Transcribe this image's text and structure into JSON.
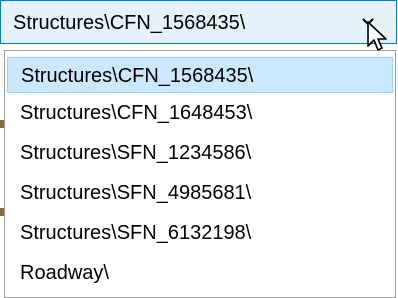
{
  "combo": {
    "value": "Structures\\CFN_1568435\\",
    "arrow_icon": "chevron-down-icon"
  },
  "dropdown": {
    "options": [
      {
        "label": "Structures\\CFN_1568435\\",
        "selected": true
      },
      {
        "label": "Structures\\CFN_1648453\\",
        "selected": false
      },
      {
        "label": "Structures\\SFN_1234586\\",
        "selected": false
      },
      {
        "label": "Structures\\SFN_4985681\\",
        "selected": false
      },
      {
        "label": "Structures\\SFN_6132198\\",
        "selected": false
      },
      {
        "label": "Roadway\\",
        "selected": false
      }
    ]
  },
  "colors": {
    "combo_background": "#e5f1fb",
    "combo_border": "#0078d7",
    "selected_background": "#cce8ff",
    "selected_border": "#99d1ff",
    "list_border": "#a0a0a0"
  }
}
